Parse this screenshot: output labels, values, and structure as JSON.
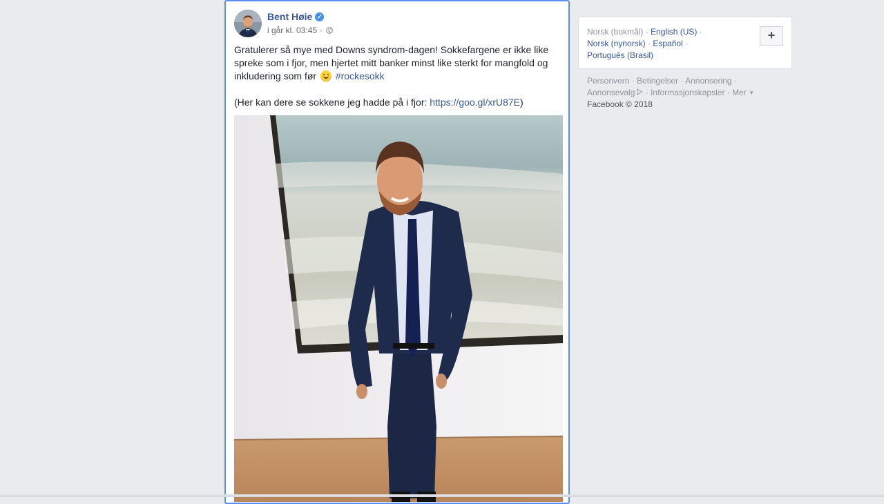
{
  "post": {
    "author": "Bent Høie",
    "verified": true,
    "timestamp": "i går kl. 03:45",
    "privacy_icon": "globe-icon",
    "text_line1": "Gratulerer så mye med Downs syndrom-dagen! Sokkefargene er ikke like spreke som i fjor, men hjertet mitt banker minst like sterkt for mangfold og inkludering som før",
    "emoji": "smiling-face-icon",
    "hashtag": "#rockesokk",
    "text_line2_prefix": "(Her kan dere se sokkene jeg hadde på i fjor: ",
    "link": "https://goo.gl/xrU87E",
    "text_line2_suffix": ")",
    "accent_color": "#365899"
  },
  "languages": {
    "current": "Norsk (bokmål)",
    "options": [
      "English (US)",
      "Norsk (nynorsk)",
      "Español",
      "Português (Brasil)"
    ],
    "add_button": "+"
  },
  "footer": {
    "links": [
      "Personvern",
      "Betingelser",
      "Annonsering",
      "Annonsevalg",
      "Informasjonskapsler",
      "Mer"
    ],
    "copyright": "Facebook © 2018"
  },
  "colors": {
    "background": "#e9ebee",
    "link": "#365899",
    "muted": "#90949c",
    "selection_border": "#5b8ef0"
  }
}
